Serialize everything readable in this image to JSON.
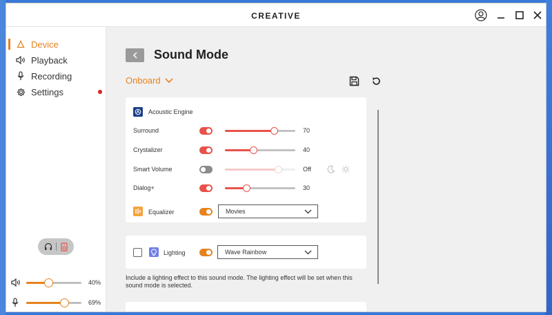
{
  "window": {
    "brand": "CREATIVE"
  },
  "sidebar": {
    "items": [
      {
        "label": "Device",
        "icon": "speaker-triangle-icon",
        "active": true
      },
      {
        "label": "Playback",
        "icon": "speaker-icon"
      },
      {
        "label": "Recording",
        "icon": "microphone-icon"
      },
      {
        "label": "Settings",
        "icon": "gear-icon"
      }
    ],
    "output_volume": {
      "label": "40%",
      "value": 40
    },
    "mic_volume": {
      "label": "69%",
      "value": 69
    }
  },
  "main": {
    "title": "Sound Mode",
    "profile": "Onboard",
    "acoustic_engine": {
      "title": "Acoustic Engine",
      "features": [
        {
          "name": "Surround",
          "value": "70",
          "level": 70,
          "enabled": true
        },
        {
          "name": "Crystalizer",
          "value": "40",
          "level": 40,
          "enabled": true
        },
        {
          "name": "Smart Volume",
          "value": "Off",
          "level": 75,
          "enabled": false
        },
        {
          "name": "Dialog+",
          "value": "30",
          "level": 30,
          "enabled": true
        }
      ],
      "equalizer": {
        "label": "Equalizer",
        "preset": "Movies",
        "enabled": true
      }
    },
    "lighting": {
      "label": "Lighting",
      "preset": "Wave Rainbow",
      "enabled": true,
      "checked": false,
      "note": "Include a lighting effect to this sound mode. The lighting effect will be set when this sound mode is selected."
    }
  },
  "colors": {
    "accent": "#e6821e",
    "toggle_red": "#e8524a"
  }
}
